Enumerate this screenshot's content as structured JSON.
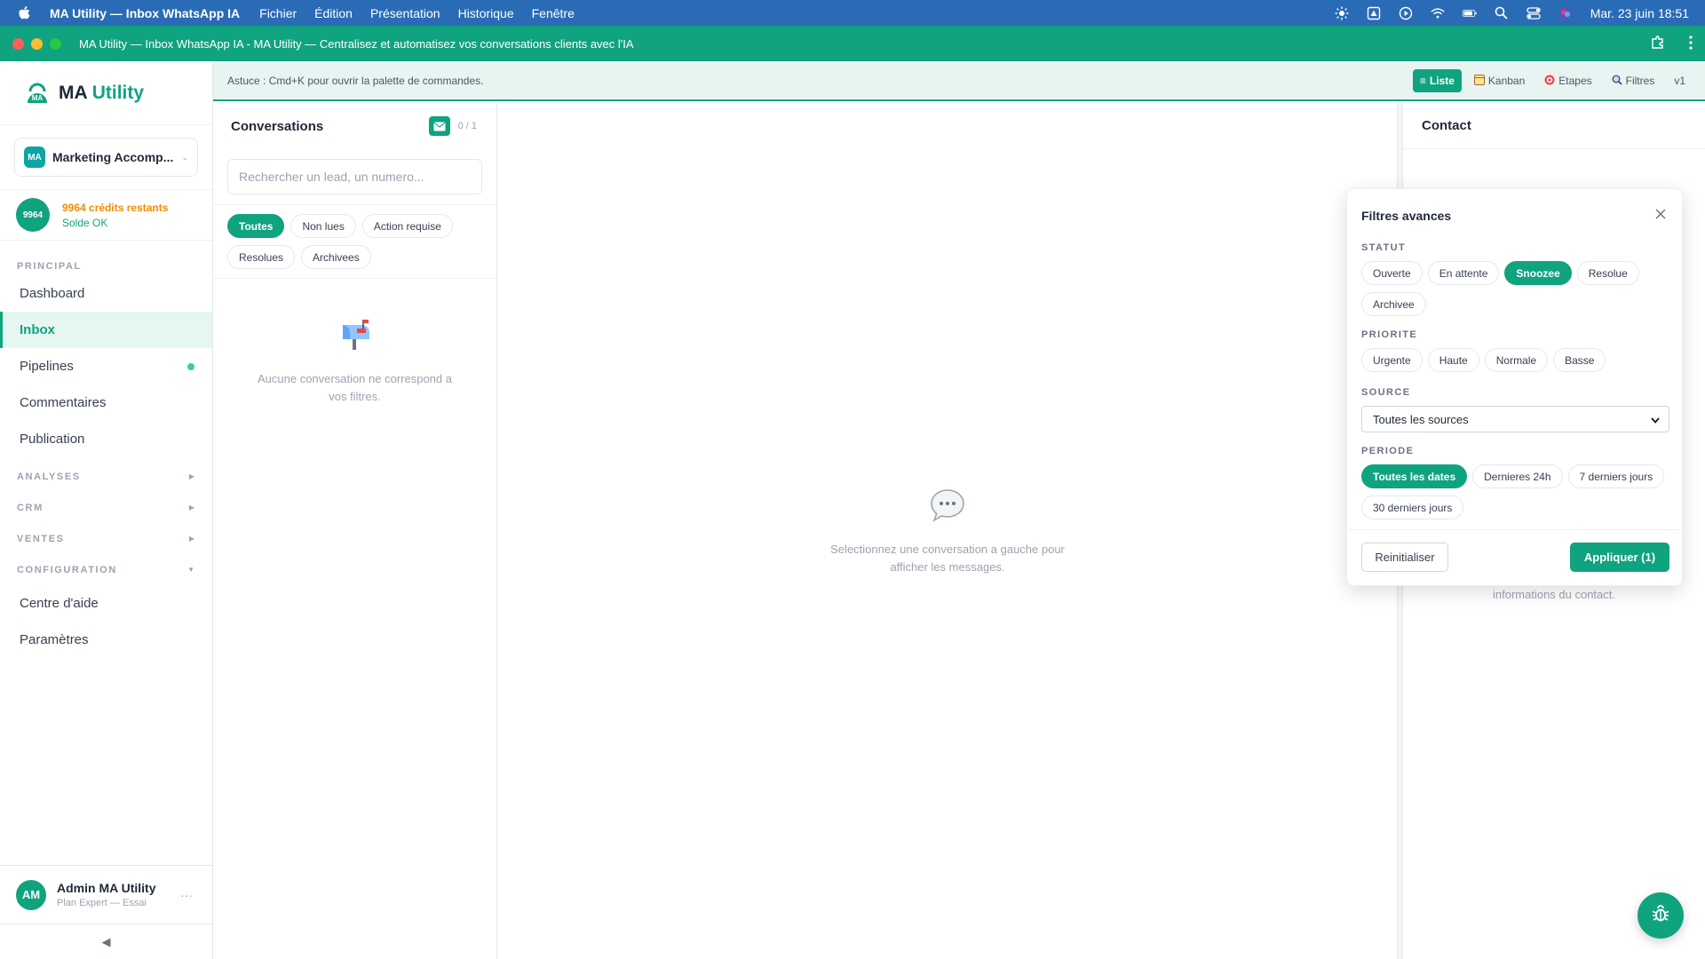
{
  "menubar": {
    "app_name": "MA Utility — Inbox WhatsApp IA",
    "items": [
      "Fichier",
      "Édition",
      "Présentation",
      "Historique",
      "Fenêtre"
    ],
    "clock": "Mar. 23 juin  18:51"
  },
  "window": {
    "title": "MA Utility — Inbox WhatsApp IA - MA Utility — Centralisez et automatisez vos conversations clients avec l'IA"
  },
  "sidebar": {
    "logo_main": "MA",
    "logo_accent": "Utility",
    "workspace": {
      "badge": "MA",
      "name": "Marketing Accomp..."
    },
    "credits": {
      "badge": "9964",
      "remaining": "9964 crédits restants",
      "status": "Solde OK"
    },
    "section_principal": "PRINCIPAL",
    "nav": [
      {
        "label": "Dashboard"
      },
      {
        "label": "Inbox"
      },
      {
        "label": "Pipelines"
      },
      {
        "label": "Commentaires"
      },
      {
        "label": "Publication"
      }
    ],
    "sections": [
      "ANALYSES",
      "CRM",
      "VENTES",
      "CONFIGURATION"
    ],
    "config_items": [
      "Centre d'aide",
      "Paramètres"
    ],
    "user": {
      "initials": "AM",
      "name": "Admin MA Utility",
      "plan": "Plan Expert — Essai"
    }
  },
  "tipbar": {
    "tip": "Astuce : Cmd+K pour ouvrir la palette de commandes.",
    "views": [
      "Liste",
      "Kanban",
      "Etapes",
      "Filtres",
      "v1"
    ]
  },
  "conversations": {
    "title": "Conversations",
    "count": "0 / 1",
    "search_placeholder": "Rechercher un lead, un numero...",
    "tabs": [
      "Toutes",
      "Non lues",
      "Action requise",
      "Resolues",
      "Archivees"
    ],
    "empty_message": "Aucune conversation ne correspond a vos filtres."
  },
  "chat": {
    "empty_message": "Selectionnez une conversation a gauche pour afficher les messages."
  },
  "contact": {
    "title": "Contact",
    "hint": "informations du contact."
  },
  "filters": {
    "title": "Filtres avances",
    "statut_label": "STATUT",
    "statut": [
      "Ouverte",
      "En attente",
      "Snoozee",
      "Resolue",
      "Archivee"
    ],
    "priorite_label": "PRIORITE",
    "priorite": [
      "Urgente",
      "Haute",
      "Normale",
      "Basse"
    ],
    "source_label": "SOURCE",
    "source_value": "Toutes les sources",
    "periode_label": "PERIODE",
    "periode": [
      "Toutes les dates",
      "Dernieres 24h",
      "7 derniers jours",
      "30 derniers jours"
    ],
    "reset": "Reinitialiser",
    "apply": "Appliquer (1)"
  },
  "colors": {
    "accent": "#10a37f",
    "menubar": "#2a6bb5",
    "credits_warn": "#f08c00"
  }
}
